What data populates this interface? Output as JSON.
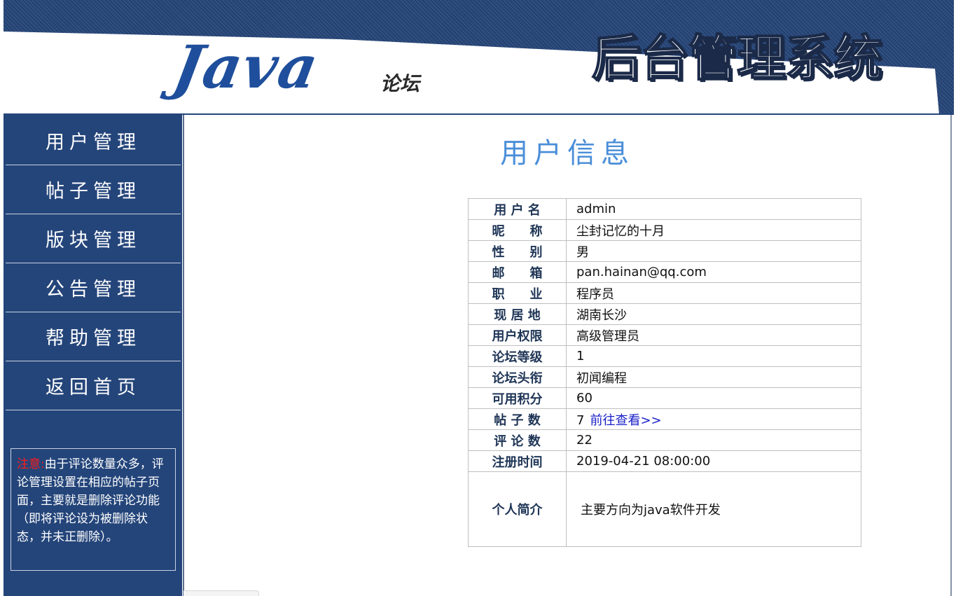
{
  "header": {
    "logo_text": "Java",
    "logo_sub": "论坛",
    "system_title": "后台管理系统"
  },
  "sidebar": {
    "items": [
      {
        "label": "用户管理"
      },
      {
        "label": "帖子管理"
      },
      {
        "label": "版块管理"
      },
      {
        "label": "公告管理"
      },
      {
        "label": "帮助管理"
      },
      {
        "label": "返回首页"
      }
    ],
    "notice": {
      "label": "注意:",
      "text": "由于评论数量众多，评论管理设置在相应的帖子页面，主要就是删除评论功能（即将评论设为被删除状态，并未正删除）。"
    }
  },
  "main": {
    "title": "用户信息",
    "rows": [
      {
        "label": "用 户 名",
        "value": "admin"
      },
      {
        "label": "昵　　称",
        "value": "尘封记忆的十月"
      },
      {
        "label": "性　　别",
        "value": "男"
      },
      {
        "label": "邮　　箱",
        "value": "pan.hainan@qq.com"
      },
      {
        "label": "职　　业",
        "value": "程序员"
      },
      {
        "label": "现 居 地",
        "value": "湖南长沙"
      },
      {
        "label": "用户权限",
        "value": "高级管理员"
      },
      {
        "label": "论坛等级",
        "value": "1"
      },
      {
        "label": "论坛头衔",
        "value": "初闻编程"
      },
      {
        "label": "可用积分",
        "value": "60"
      },
      {
        "label": "帖 子 数",
        "value": "7",
        "link": "前往查看>>"
      },
      {
        "label": "评 论 数",
        "value": "22"
      },
      {
        "label": "注册时间",
        "value": "2019-04-21 08:00:00"
      }
    ],
    "bio": {
      "label": "个人简介",
      "value": "主要方向为java软件开发"
    }
  }
}
